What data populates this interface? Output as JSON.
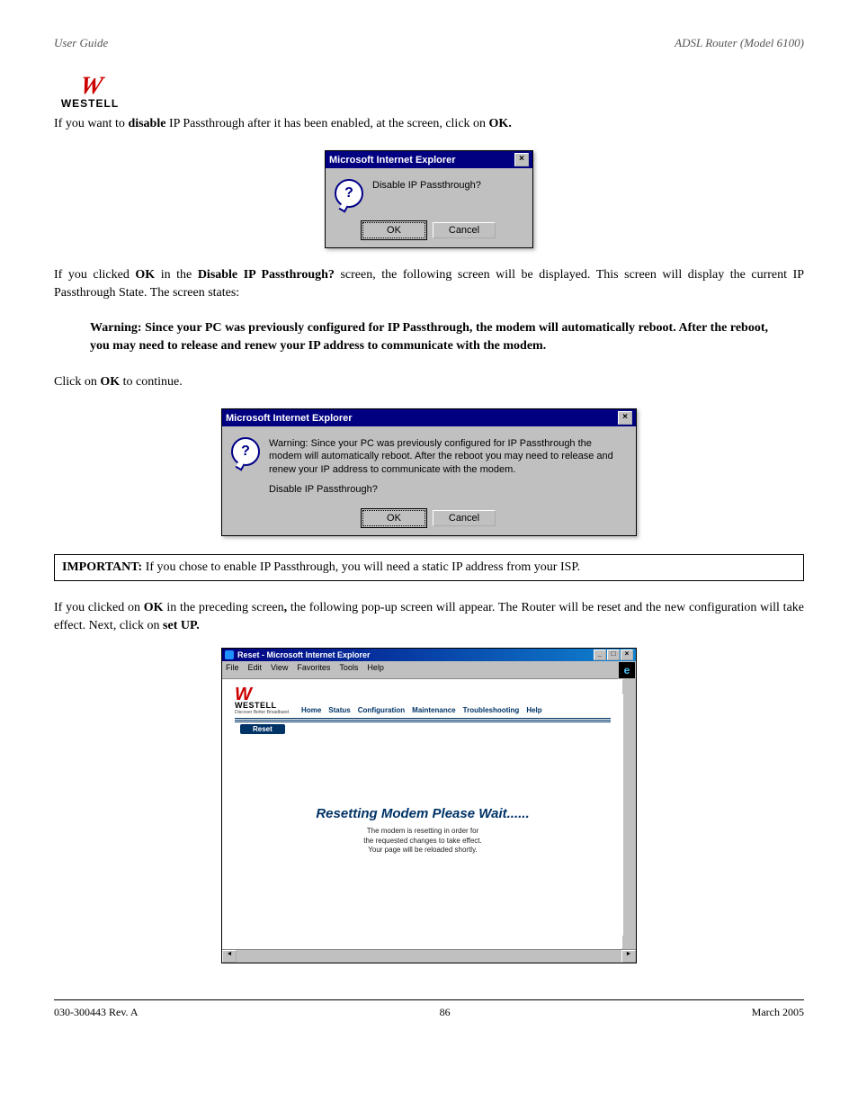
{
  "header": {
    "left": "User Guide",
    "right": "ADSL Router (Model 6100)",
    "logo_text": "WESTELL"
  },
  "section1": {
    "para1_a": "If you want to ",
    "para1_b": "disable",
    "para1_c": " IP Passthrough after it has been enabled, at the screen, click on ",
    "para1_d": "OK."
  },
  "dialog1": {
    "title": "Microsoft Internet Explorer",
    "text": "Disable IP Passthrough?",
    "ok": "OK",
    "cancel": "Cancel"
  },
  "section2": {
    "a": "If you clicked ",
    "b": "OK",
    "c": " in the ",
    "d": "Disable IP Passthrough?",
    "e": " screen, the following screen will be displayed. This screen will display the current IP Passthrough State. The screen states:"
  },
  "warning": "Warning: Since your PC was previously configured for IP Passthrough, the modem will automatically reboot. After the reboot, you may need to release and renew your IP address to communicate with the modem.",
  "section3": {
    "a": "Click on ",
    "b": "OK",
    "c": " to continue."
  },
  "dialog2": {
    "title": "Microsoft Internet Explorer",
    "line1": "Warning: Since your PC was previously configured for IP Passthrough the modem will automatically reboot. After the reboot you may need to release and renew your IP address to communicate with the modem.",
    "line2": "Disable IP Passthrough?",
    "ok": "OK",
    "cancel": "Cancel"
  },
  "important": {
    "label": "IMPORTANT:",
    "text": " If you chose to enable IP Passthrough, you will need a static IP address from your ISP."
  },
  "section4": {
    "a": "If you clicked on ",
    "b": "OK",
    "c": " in the preceding screen",
    "d": ",",
    "e": " the following pop-up screen will appear. The Router will be reset and the new configuration will take effect. Next, click on ",
    "f": "set UP."
  },
  "browser": {
    "title": "Reset - Microsoft Internet Explorer",
    "menu": [
      "File",
      "Edit",
      "View",
      "Favorites",
      "Tools",
      "Help"
    ],
    "logo_text": "WESTELL",
    "logo_tag": "Discover Better Broadband",
    "nav": [
      "Home",
      "Status",
      "Configuration",
      "Maintenance",
      "Troubleshooting",
      "Help"
    ],
    "tab": "Reset",
    "reset_title": "Resetting Modem Please Wait......",
    "reset_sub1": "The modem is resetting in order for",
    "reset_sub2": "the requested changes to take effect.",
    "reset_sub3": "Your page will be reloaded shortly."
  },
  "footer": {
    "left": "030-300443 Rev. A",
    "center": "86",
    "right": "March 2005"
  }
}
